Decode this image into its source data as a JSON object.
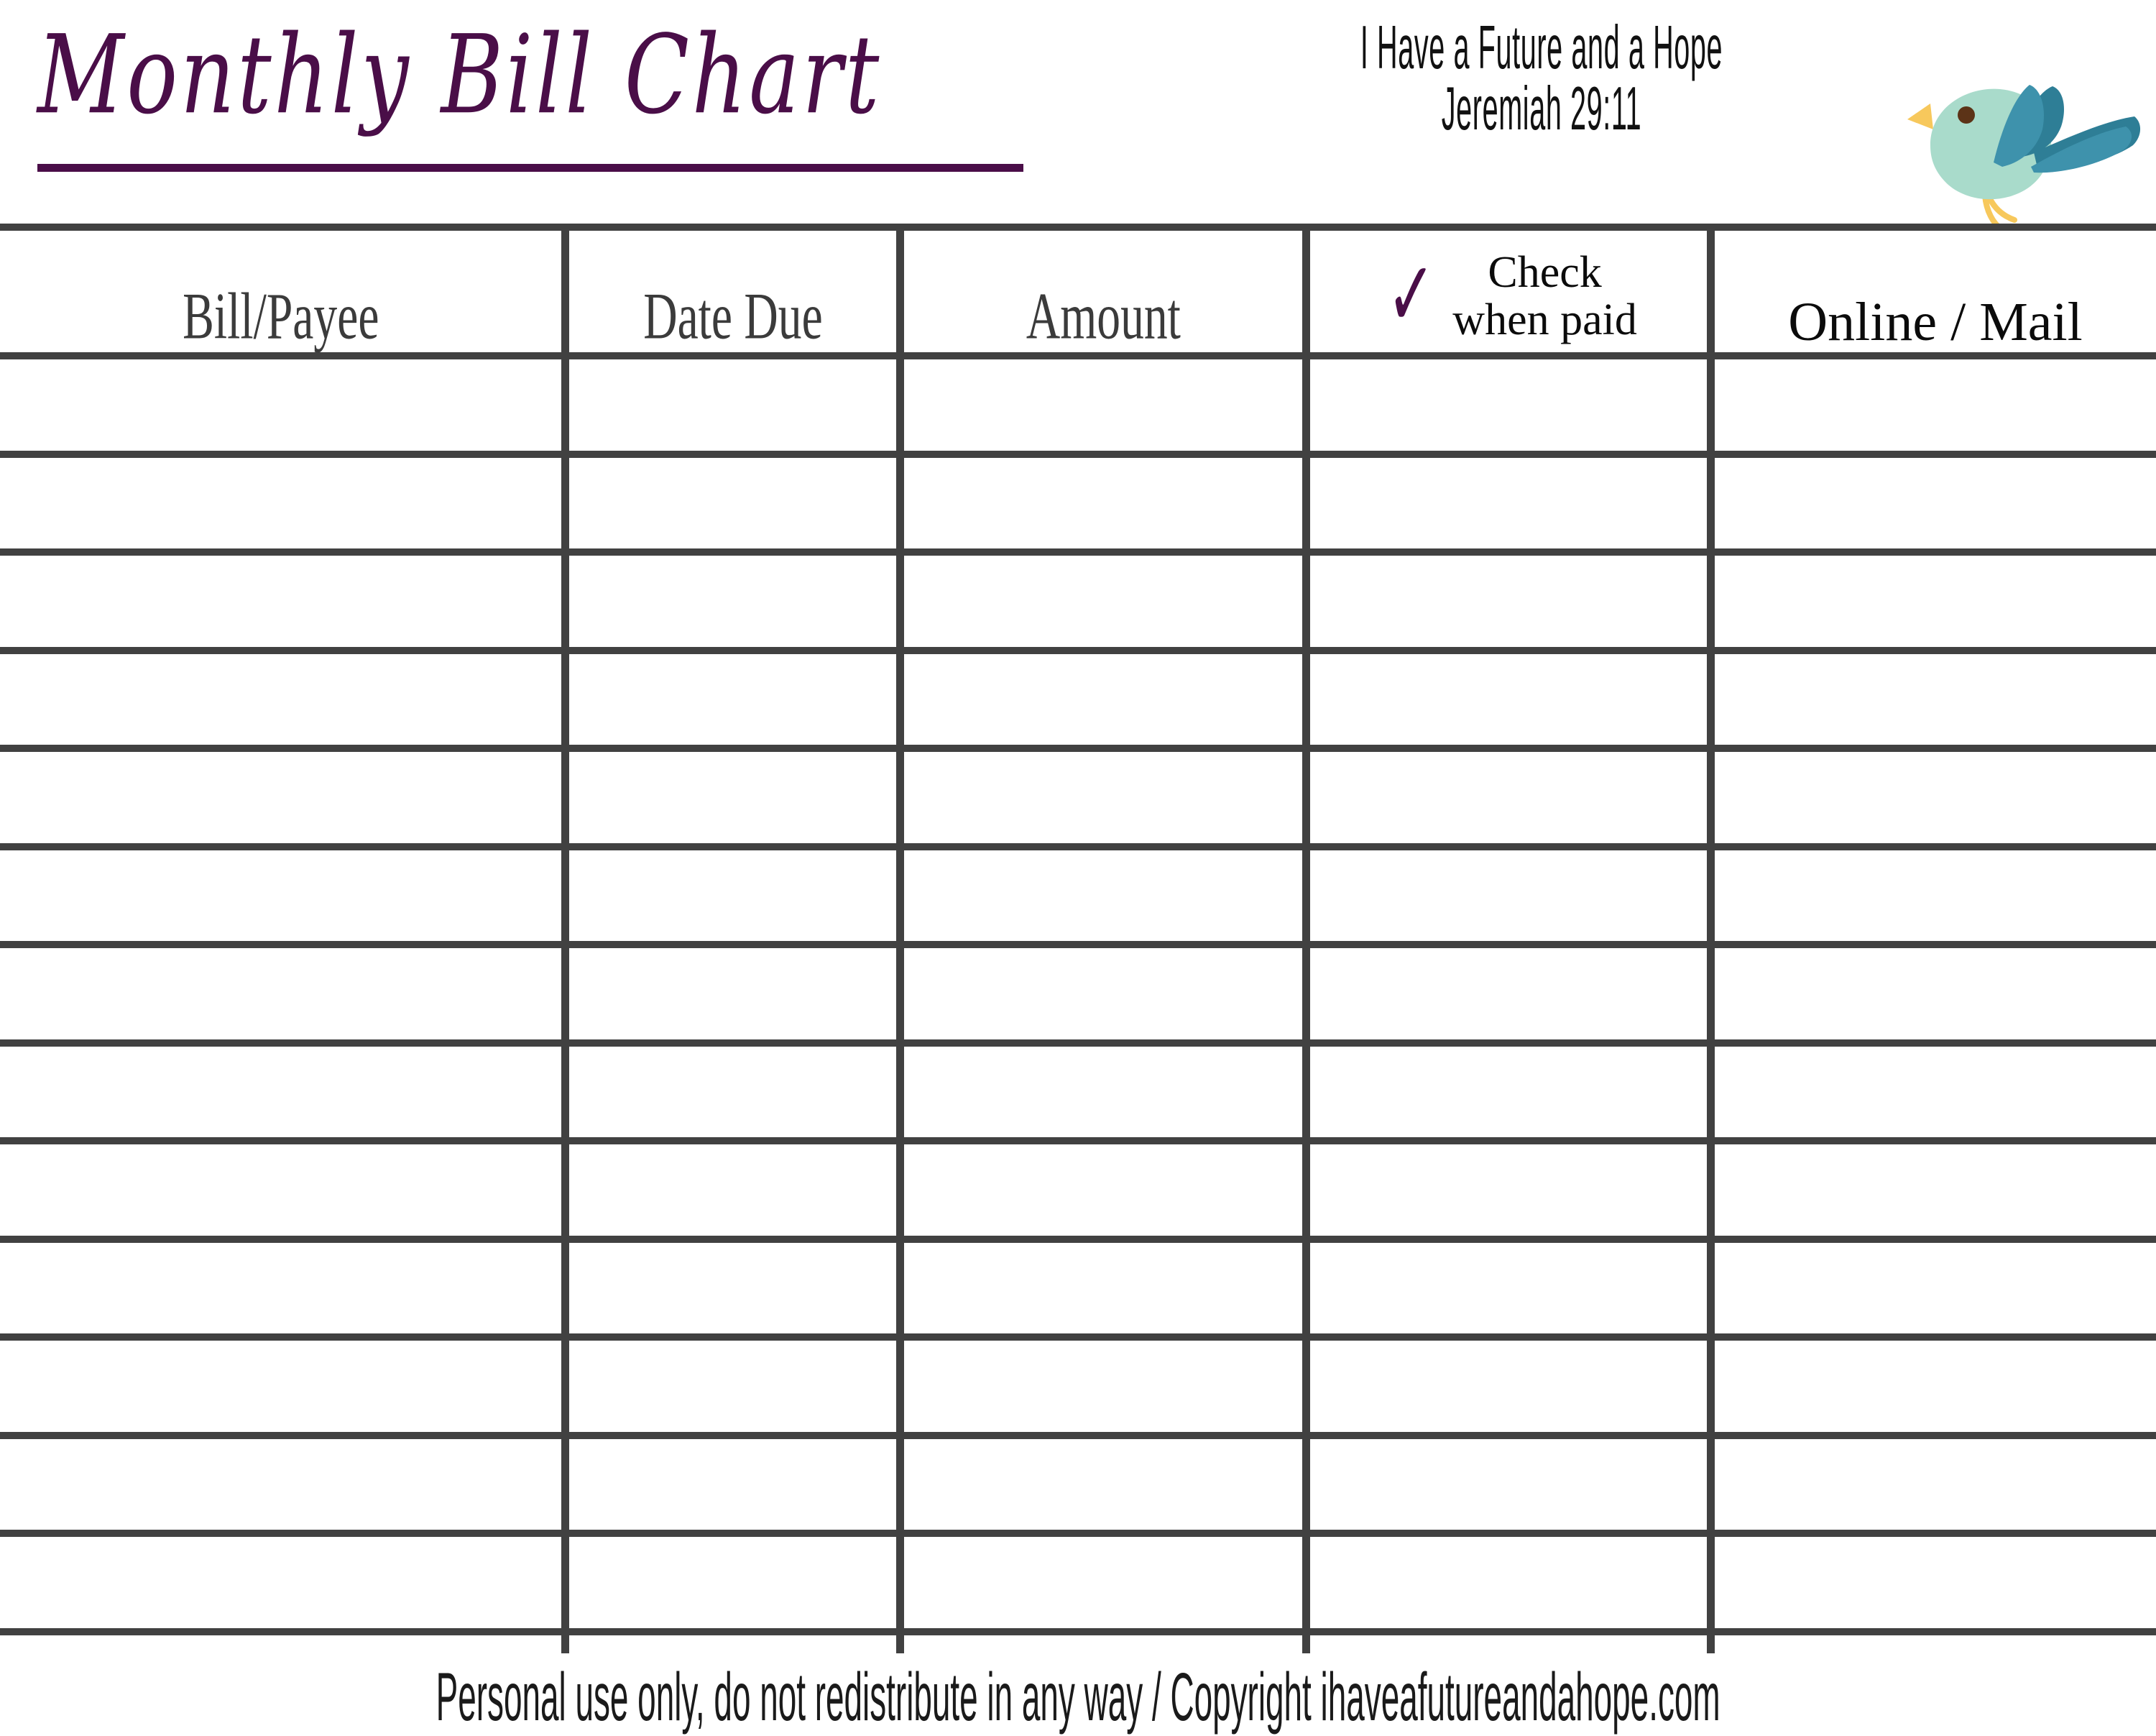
{
  "document": {
    "title": "Monthly Bill Chart",
    "type": "printable-bill-tracker-worksheet"
  },
  "header": {
    "title": "Monthly Bill Chart",
    "tagline_line1": "I Have a Future and a Hope",
    "tagline_line2": "Jeremiah 29:11",
    "bird_icon_name": "flying-bird-icon"
  },
  "table": {
    "columns": [
      {
        "id": "bill-payee",
        "label": "Bill/Payee",
        "style": "condensed-serif"
      },
      {
        "id": "date-due",
        "label": "Date Due",
        "style": "condensed-serif"
      },
      {
        "id": "amount",
        "label": "Amount",
        "style": "condensed-serif"
      },
      {
        "id": "check-paid",
        "label_line1": "Check",
        "label_line2": "when paid",
        "checkmark": "✓",
        "style": "serif-with-check"
      },
      {
        "id": "online-mail",
        "label": "Online / Mail",
        "style": "serif"
      }
    ],
    "row_count": 13,
    "rows": [
      {
        "bill_payee": "",
        "date_due": "",
        "amount": "",
        "check_paid": "",
        "online_mail": ""
      },
      {
        "bill_payee": "",
        "date_due": "",
        "amount": "",
        "check_paid": "",
        "online_mail": ""
      },
      {
        "bill_payee": "",
        "date_due": "",
        "amount": "",
        "check_paid": "",
        "online_mail": ""
      },
      {
        "bill_payee": "",
        "date_due": "",
        "amount": "",
        "check_paid": "",
        "online_mail": ""
      },
      {
        "bill_payee": "",
        "date_due": "",
        "amount": "",
        "check_paid": "",
        "online_mail": ""
      },
      {
        "bill_payee": "",
        "date_due": "",
        "amount": "",
        "check_paid": "",
        "online_mail": ""
      },
      {
        "bill_payee": "",
        "date_due": "",
        "amount": "",
        "check_paid": "",
        "online_mail": ""
      },
      {
        "bill_payee": "",
        "date_due": "",
        "amount": "",
        "check_paid": "",
        "online_mail": ""
      },
      {
        "bill_payee": "",
        "date_due": "",
        "amount": "",
        "check_paid": "",
        "online_mail": ""
      },
      {
        "bill_payee": "",
        "date_due": "",
        "amount": "",
        "check_paid": "",
        "online_mail": ""
      },
      {
        "bill_payee": "",
        "date_due": "",
        "amount": "",
        "check_paid": "",
        "online_mail": ""
      },
      {
        "bill_payee": "",
        "date_due": "",
        "amount": "",
        "check_paid": "",
        "online_mail": ""
      },
      {
        "bill_payee": "",
        "date_due": "",
        "amount": "",
        "check_paid": "",
        "online_mail": ""
      }
    ]
  },
  "footer": {
    "text": "Personal use only, do not redistribute in any way / Copyright ihaveafutureandahope.com"
  },
  "colors": {
    "title_purple": "#4A0E48",
    "grid_gray": "#414141",
    "header_text_gray": "#3B3B3B",
    "header_text_black": "#0B0B0B",
    "bird_body": "#A9DBCB",
    "bird_wing_light": "#3E92AC",
    "bird_wing_dark": "#2E7E96",
    "bird_beak": "#F7C85C",
    "bird_eye": "#5C3317",
    "page_background": "#FFFFFF"
  }
}
